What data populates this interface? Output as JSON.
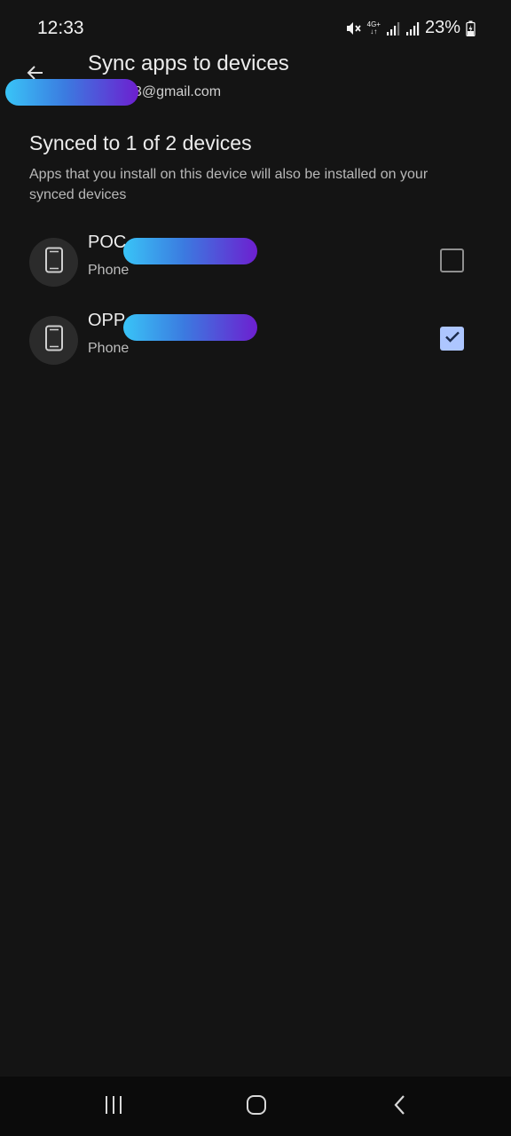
{
  "status_bar": {
    "time": "12:33",
    "network_label_top": "4G+",
    "network_label_bottom": "↓↑",
    "battery": "23%"
  },
  "app_bar": {
    "title": "Sync apps to devices",
    "email_suffix": "3@gmail.com"
  },
  "section": {
    "title": "Synced to 1 of 2 devices",
    "description": "Apps that you install on this device will also be installed on your synced devices"
  },
  "devices": [
    {
      "name": "POC",
      "type": "Phone",
      "checked": false,
      "icon": "phone-icon"
    },
    {
      "name": "OPP",
      "type": "Phone",
      "checked": true,
      "icon": "phone-icon"
    }
  ],
  "nav": {
    "recents_icon": "recents-icon",
    "home_icon": "home-icon",
    "back_icon": "back-icon"
  },
  "colors": {
    "background": "#141414",
    "checkbox_checked": "#adc6ff",
    "redaction_start": "#39c4f7",
    "redaction_end": "#6d1fd0"
  }
}
